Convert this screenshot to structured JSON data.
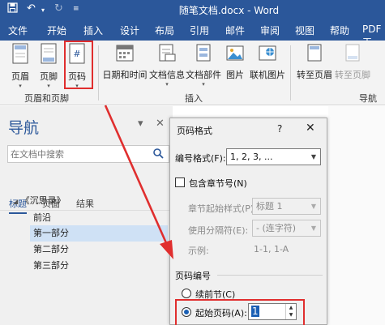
{
  "window": {
    "title": "随笔文档.docx - Word"
  },
  "tabs": [
    "文件",
    "开始",
    "插入",
    "设计",
    "布局",
    "引用",
    "邮件",
    "审阅",
    "视图",
    "帮助",
    "PDF工"
  ],
  "ribbon": {
    "header_footer": {
      "items": [
        "页眉",
        "页脚",
        "页码"
      ],
      "label": "页眉和页脚"
    },
    "insert": {
      "items": [
        "日期和时间",
        "文档信息",
        "文档部件",
        "图片",
        "联机图片"
      ],
      "label": "插入"
    },
    "navigation": {
      "items": [
        "转至页眉",
        "转至页脚"
      ],
      "label": "导航"
    }
  },
  "nav_pane": {
    "title": "导航",
    "search_placeholder": "在文档中搜索",
    "tabs": [
      "标题",
      "页面",
      "结果"
    ],
    "tree": {
      "root": "《沉思录》",
      "children": [
        "前沿",
        "第一部分",
        "第二部分",
        "第三部分"
      ],
      "selected": "第一部分"
    }
  },
  "dialog": {
    "title": "页码格式",
    "help": "?",
    "close": "✕",
    "number_format_label": "编号格式(F):",
    "number_format_value": "1, 2, 3, ...",
    "include_chapter_label": "包含章节号(N)",
    "chapter_style_label": "章节起始样式(P)",
    "chapter_style_value": "标题 1",
    "separator_label": "使用分隔符(E):",
    "separator_value": "- (连字符)",
    "example_label": "示例:",
    "example_value": "1-1, 1-A",
    "page_numbering_label": "页码编号",
    "continue_label": "续前节(C)",
    "start_at_label": "起始页码(A):",
    "start_at_value": "1",
    "selected_option": "start_at"
  },
  "colors": {
    "word_blue": "#2b579a",
    "highlight_red": "#e02e2e",
    "selection": "#cfe1f5"
  }
}
